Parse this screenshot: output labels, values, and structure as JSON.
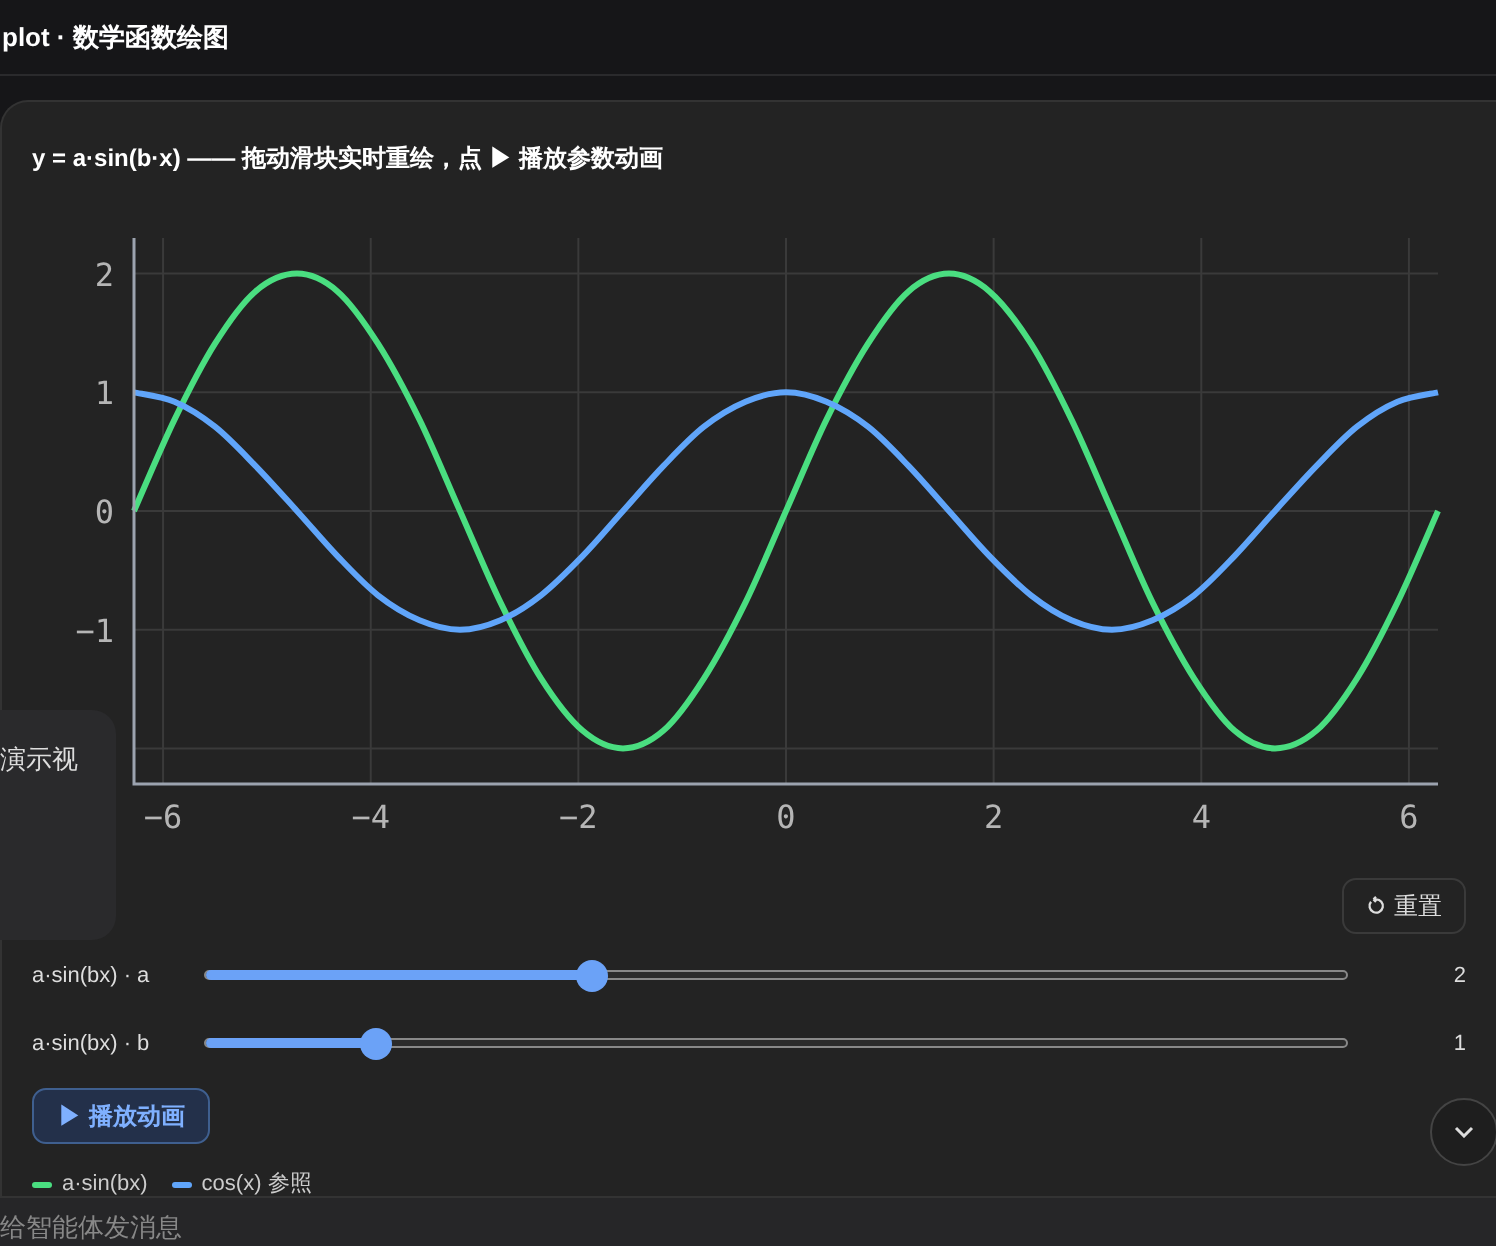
{
  "app_title": "plot · 数学函数绘图",
  "card": {
    "caption": "y = a·sin(b·x) —— 拖动滑块实时重绘，点 ▶ 播放参数动画",
    "chart_data": {
      "type": "line",
      "grid": true,
      "xlim": [
        -6.28,
        6.28
      ],
      "ylim": [
        -2.3,
        2.3
      ],
      "xticks": [
        -6,
        -4,
        -2,
        0,
        2,
        4,
        6
      ],
      "yticks": [
        -1,
        0,
        1,
        2
      ],
      "x": [
        -6.28,
        -5.89,
        -5.5,
        -5.11,
        -4.71,
        -4.32,
        -3.93,
        -3.53,
        -3.14,
        -2.75,
        -2.36,
        -1.96,
        -1.57,
        -1.18,
        -0.79,
        -0.39,
        0,
        0.39,
        0.79,
        1.18,
        1.57,
        1.96,
        2.36,
        2.75,
        3.14,
        3.53,
        3.93,
        4.32,
        4.71,
        5.11,
        5.5,
        5.89,
        6.28
      ],
      "series": [
        {
          "name": "a·sin(bx)",
          "color": "#4ade80",
          "values": [
            0,
            0.77,
            1.41,
            1.85,
            2,
            1.85,
            1.41,
            0.77,
            0,
            -0.77,
            -1.41,
            -1.85,
            -2,
            -1.85,
            -1.41,
            -0.77,
            0,
            0.77,
            1.41,
            1.85,
            2,
            1.85,
            1.41,
            0.77,
            0,
            -0.77,
            -1.41,
            -1.85,
            -2,
            -1.85,
            -1.41,
            -0.77,
            0
          ]
        },
        {
          "name": "cos(x) 参照",
          "color": "#60a5fa",
          "values": [
            1,
            0.92,
            0.71,
            0.38,
            0,
            -0.38,
            -0.71,
            -0.92,
            -1,
            -0.92,
            -0.71,
            -0.38,
            0,
            0.38,
            0.71,
            0.92,
            1,
            0.92,
            0.71,
            0.38,
            0,
            -0.38,
            -0.71,
            -0.92,
            -1,
            -0.92,
            -0.71,
            -0.38,
            0,
            0.38,
            0.71,
            0.92,
            1
          ]
        }
      ]
    },
    "reset_button": "重置",
    "sliders": [
      {
        "label": "a·sin(bx) · a",
        "level": 0.34,
        "reading": "2"
      },
      {
        "label": "a·sin(bx) · b",
        "level": 0.15,
        "reading": "1"
      }
    ],
    "play_button": "▶ 播放动画"
  },
  "floating_panel": {
    "text": "演示视"
  },
  "message_input": {
    "placeholder": "给智能体发消息"
  }
}
